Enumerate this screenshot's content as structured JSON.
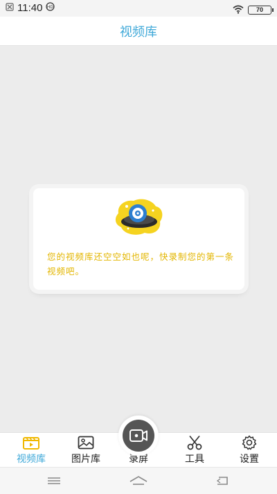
{
  "status_bar": {
    "time": "11:40",
    "battery": "70",
    "icons": [
      "notification-icon",
      "hd-icon",
      "wifi-icon",
      "battery-icon"
    ]
  },
  "header": {
    "title": "视频库"
  },
  "empty_state": {
    "message": "您的视频库还空空如也呢，快录制您的第一条视频吧。",
    "illustration": "film-reel-icon"
  },
  "tab_bar": {
    "active_color": "#3ea8d8",
    "tabs": [
      {
        "label": "视频库",
        "icon": "video-library-icon",
        "active": true
      },
      {
        "label": "图片库",
        "icon": "image-icon",
        "active": false
      },
      {
        "label": "录屏",
        "icon": "record-camera-icon",
        "active": false
      },
      {
        "label": "工具",
        "icon": "scissors-icon",
        "active": false
      },
      {
        "label": "设置",
        "icon": "gear-icon",
        "active": false
      }
    ]
  },
  "nav_bar": {
    "buttons": [
      "menu-icon",
      "home-icon",
      "back-icon"
    ]
  },
  "colors": {
    "title": "#3ea8d8",
    "message": "#e3b600",
    "background": "#ececec"
  }
}
